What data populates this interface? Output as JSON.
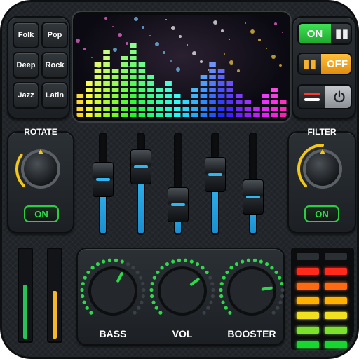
{
  "app": {
    "accent": "#2ecc40",
    "brand_blue": "#2aa9e8"
  },
  "presets": [
    {
      "label": "Folk"
    },
    {
      "label": "Pop"
    },
    {
      "label": "Deep"
    },
    {
      "label": "Rock"
    },
    {
      "label": "Jazz"
    },
    {
      "label": "Latin"
    }
  ],
  "switches": {
    "power_on": {
      "label": "ON",
      "state": true,
      "color": "#2ecc40"
    },
    "power_off": {
      "label": "OFF",
      "state": false,
      "color": "#f5a623"
    },
    "power_toggle_icon": "power-icon"
  },
  "rotate": {
    "label": "ROTATE",
    "button": "ON",
    "level": 0.3
  },
  "filter": {
    "label": "FILTER",
    "button": "ON",
    "level": 0.5
  },
  "equalizer": {
    "levels": [
      0.62,
      0.78,
      0.29,
      0.68,
      0.39
    ]
  },
  "vu_left": {
    "levels": [
      0.62,
      0.55
    ],
    "colors": [
      "#27c35a",
      "#f5b62a"
    ]
  },
  "knobs": [
    {
      "label": "BASS",
      "level": 0.6
    },
    {
      "label": "VOL",
      "level": 0.7
    },
    {
      "label": "BOOSTER",
      "level": 0.8
    }
  ],
  "led_meter": {
    "colors": [
      "#ff2a1a",
      "#ff6a10",
      "#ffb000",
      "#f0e020",
      "#7be12c",
      "#17d630"
    ],
    "lit_rows": 6
  }
}
